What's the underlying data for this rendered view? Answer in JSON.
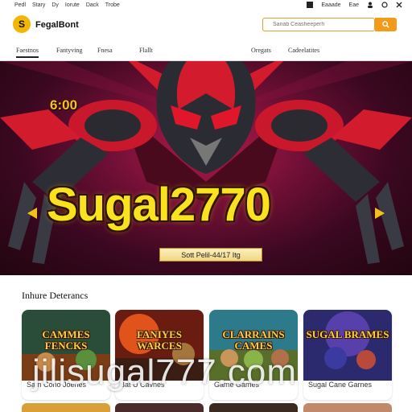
{
  "topbar": {
    "links": [
      "Pedl",
      "Stary",
      "Dy",
      "Iorute",
      "Dack",
      "Trobe"
    ],
    "right": [
      "Eaaade",
      "Eae"
    ]
  },
  "header": {
    "logo_letter": "S",
    "brand": "FegalBont",
    "search_placeholder": "Sanab Ceasheeperh",
    "search_icon": "search-icon"
  },
  "nav": {
    "items": [
      "Faestnos",
      "Fantyving",
      "Fnesa",
      "Flallt",
      "Oregats",
      "Cadeelatites"
    ]
  },
  "hero": {
    "time": "6:00",
    "title": "Sugal2770",
    "cta": "Sott Pelil-44/17 Itg"
  },
  "section": {
    "title": "Inhure Deterancs",
    "cards": [
      {
        "image_title": "CAMMES FENCKS",
        "label": "Sam Cono Joenes"
      },
      {
        "image_title": "FANIYES WARCES",
        "label": "Bat U Cavnes"
      },
      {
        "image_title": "CLARRAINS CAMES",
        "label": "Game Games"
      },
      {
        "image_title": "SUGAL BRAMES",
        "label": "Sugal Cane Garnes"
      }
    ]
  },
  "watermark": "jilisugal777.com",
  "colors": {
    "accent": "#f29a1a",
    "hero_bg": "#6e0f34",
    "title_yellow": "#fbe21f"
  }
}
